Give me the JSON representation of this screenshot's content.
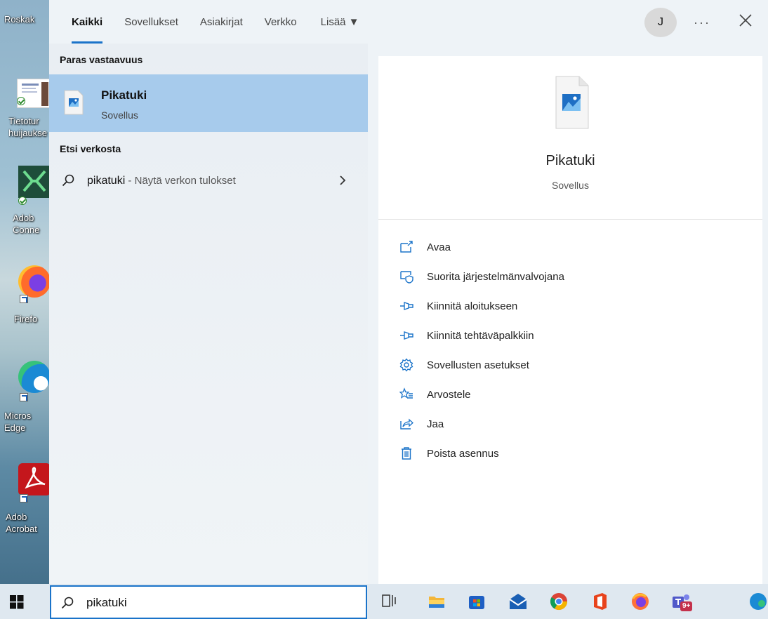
{
  "desktop": {
    "icons": [
      {
        "label": "Roskak"
      },
      {
        "label": "Tietotur\nhuijaukse"
      },
      {
        "label": "Adob\nConne"
      },
      {
        "label": "Firefo"
      },
      {
        "label": "Micros\nEdge"
      },
      {
        "label": "Adob\nAcrobat"
      }
    ]
  },
  "tabs": [
    {
      "label": "Kaikki",
      "active": true
    },
    {
      "label": "Sovellukset"
    },
    {
      "label": "Asiakirjat"
    },
    {
      "label": "Verkko"
    },
    {
      "label": "Lisää ▼"
    }
  ],
  "header": {
    "avatar": "J",
    "more": "···"
  },
  "left": {
    "best_heading": "Paras vastaavuus",
    "best": {
      "name": "Pikatuki",
      "type": "Sovellus"
    },
    "web_heading": "Etsi verkosta",
    "web": {
      "term": "pikatuki",
      "suffix": " - Näytä verkon tulokset"
    }
  },
  "right": {
    "name": "Pikatuki",
    "type": "Sovellus",
    "actions": [
      {
        "label": "Avaa",
        "icon": "open-icon"
      },
      {
        "label": "Suorita järjestelmänvalvojana",
        "icon": "admin-shield-icon"
      },
      {
        "label": "Kiinnitä aloitukseen",
        "icon": "pin-icon"
      },
      {
        "label": "Kiinnitä tehtäväpalkkiin",
        "icon": "pin-icon"
      },
      {
        "label": "Sovellusten asetukset",
        "icon": "gear-icon"
      },
      {
        "label": "Arvostele",
        "icon": "star-list-icon"
      },
      {
        "label": "Jaa",
        "icon": "share-icon"
      },
      {
        "label": "Poista asennus",
        "icon": "trash-icon"
      }
    ]
  },
  "taskbar": {
    "search_value": "pikatuki",
    "teams_badge": "9+"
  },
  "colors": {
    "accent": "#1a73c9",
    "selection": "#a7cbec"
  }
}
